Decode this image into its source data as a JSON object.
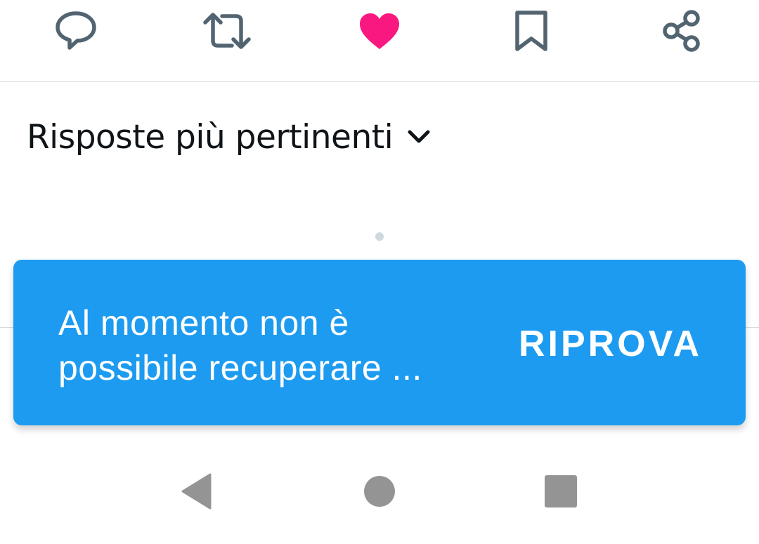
{
  "actions": {
    "reply_icon": "speech-bubble-icon",
    "retweet_icon": "retweet-icon",
    "like_icon": "heart-icon",
    "like_active": true,
    "bookmark_icon": "bookmark-icon",
    "share_icon": "share-icon"
  },
  "sort": {
    "label": "Risposte più pertinenti",
    "icon": "chevron-down-icon"
  },
  "snackbar": {
    "message_line1": "Al momento non è",
    "message_line2": "possibile recuperare ...",
    "action_label": "RIPROVA"
  },
  "nav": {
    "back_icon": "back-triangle-icon",
    "home_icon": "home-circle-icon",
    "recents_icon": "recents-square-icon"
  },
  "colors": {
    "accent": "#1d9bf0",
    "like": "#f91880",
    "icon_gray": "#536471",
    "text": "#0f1419",
    "nav_gray": "#949494"
  }
}
